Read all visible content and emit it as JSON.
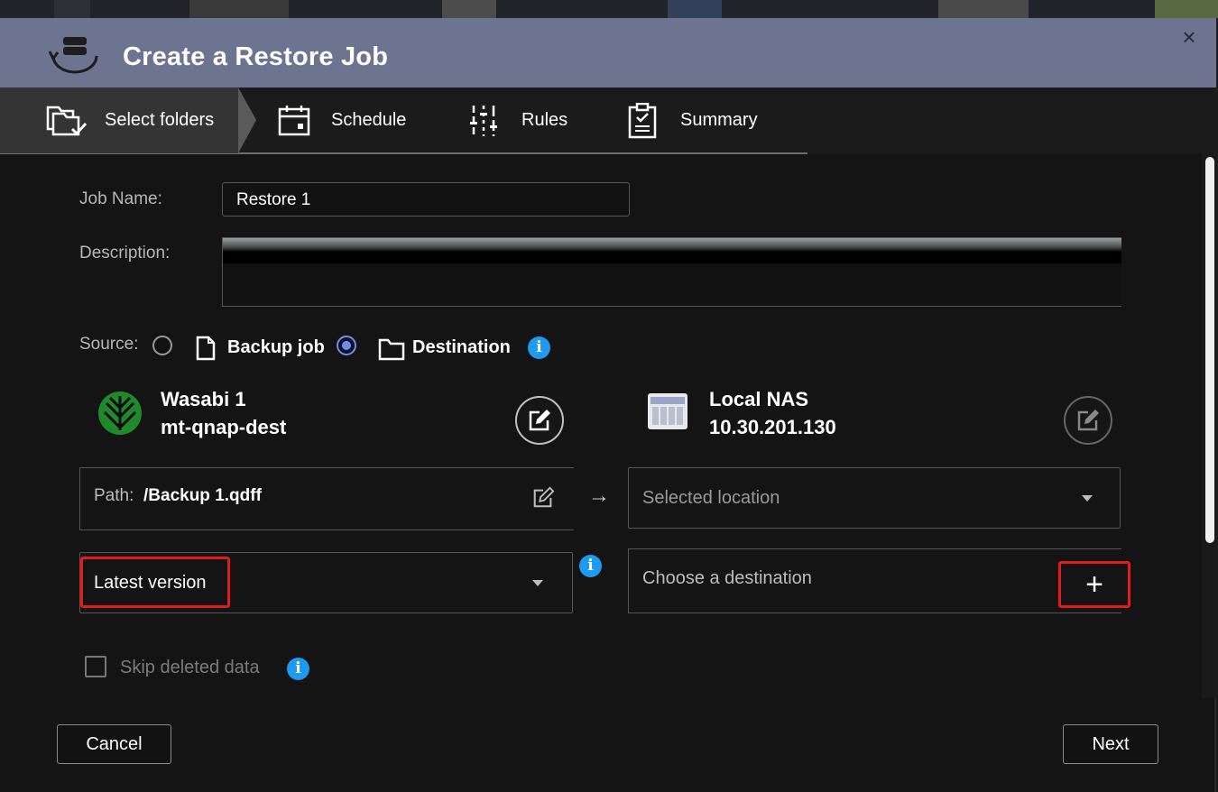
{
  "dialog": {
    "title": "Create a Restore Job",
    "close_glyph": "×"
  },
  "steps": [
    {
      "label": "Select folders",
      "icon": "folders-check-icon",
      "active": true
    },
    {
      "label": "Schedule",
      "icon": "calendar-icon",
      "active": false
    },
    {
      "label": "Rules",
      "icon": "sliders-icon",
      "active": false
    },
    {
      "label": "Summary",
      "icon": "clipboard-icon",
      "active": false
    }
  ],
  "form": {
    "job_name_label": "Job Name:",
    "job_name_value": "Restore 1",
    "description_label": "Description:",
    "description_value": "",
    "source_label": "Source:",
    "source_options": [
      {
        "label": "Backup job",
        "selected": false
      },
      {
        "label": "Destination",
        "selected": true
      }
    ]
  },
  "source": {
    "name": "Wasabi 1",
    "bucket": "mt-qnap-dest",
    "path_label": "Path:",
    "path_value": "/Backup 1.qdff",
    "version": "Latest version"
  },
  "destination": {
    "name": "Local NAS",
    "ip": "10.30.201.130",
    "location_placeholder": "Selected location",
    "choose_label": "Choose a destination",
    "add_glyph": "+"
  },
  "arrow_glyph": "→",
  "options": {
    "skip_deleted_label": "Skip deleted data",
    "skip_deleted_checked": false
  },
  "footer": {
    "cancel_label": "Cancel",
    "next_label": "Next"
  },
  "colors": {
    "titlebar": "#6d7490",
    "accent": "#6a8cff",
    "info": "#1e9af0",
    "highlight": "#e21b1b",
    "wasabi_green": "#1f8a2b"
  }
}
